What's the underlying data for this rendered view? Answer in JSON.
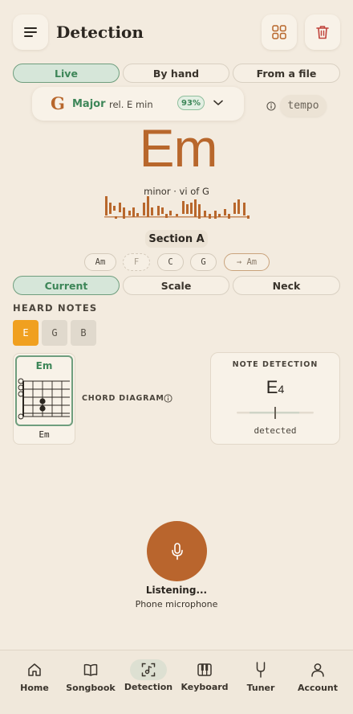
{
  "header": {
    "title": "Detection"
  },
  "modes": [
    {
      "label": "Live",
      "active": true
    },
    {
      "label": "By hand",
      "active": false
    },
    {
      "label": "From a file",
      "active": false
    }
  ],
  "key": {
    "root": "G",
    "quality": "Major",
    "relative": "rel. E min",
    "confidence": "93%"
  },
  "tempo_label": "tempo",
  "chord": {
    "name": "Em",
    "function": "minor · vi of G",
    "section": "Section A"
  },
  "progression": [
    {
      "label": "Am",
      "style": "normal"
    },
    {
      "label": "F",
      "style": "dashed"
    },
    {
      "label": "C",
      "style": "normal"
    },
    {
      "label": "G",
      "style": "normal"
    },
    {
      "label": "→ Am",
      "style": "next"
    }
  ],
  "view_tabs": [
    {
      "label": "Current",
      "active": true
    },
    {
      "label": "Scale",
      "active": false
    },
    {
      "label": "Neck",
      "active": false
    }
  ],
  "heard_notes": {
    "heading": "HEARD NOTES",
    "notes": [
      {
        "label": "E",
        "active": true
      },
      {
        "label": "G",
        "active": false
      },
      {
        "label": "B",
        "active": false
      }
    ]
  },
  "chord_diagram": {
    "title": "Em",
    "caption": "Em",
    "label": "CHORD DIAGRAM"
  },
  "note_detection": {
    "heading": "NOTE DETECTION",
    "note": "E",
    "octave": "4",
    "status": "detected"
  },
  "mic": {
    "status": "Listening...",
    "source": "Phone microphone"
  },
  "nav": [
    {
      "label": "Home",
      "icon": "home-icon",
      "active": false
    },
    {
      "label": "Songbook",
      "icon": "book-icon",
      "active": false
    },
    {
      "label": "Detection",
      "icon": "detection-icon",
      "active": true
    },
    {
      "label": "Keyboard",
      "icon": "keyboard-icon",
      "active": false
    },
    {
      "label": "Tuner",
      "icon": "tuning-fork-icon",
      "active": false
    },
    {
      "label": "Account",
      "icon": "person-icon",
      "active": false
    }
  ],
  "colors": {
    "background": "#f3ebdf",
    "accent_green": "#3d8658",
    "accent_brown": "#b8672c",
    "note_orange": "#f0a020",
    "mic_button": "#b9652d"
  }
}
